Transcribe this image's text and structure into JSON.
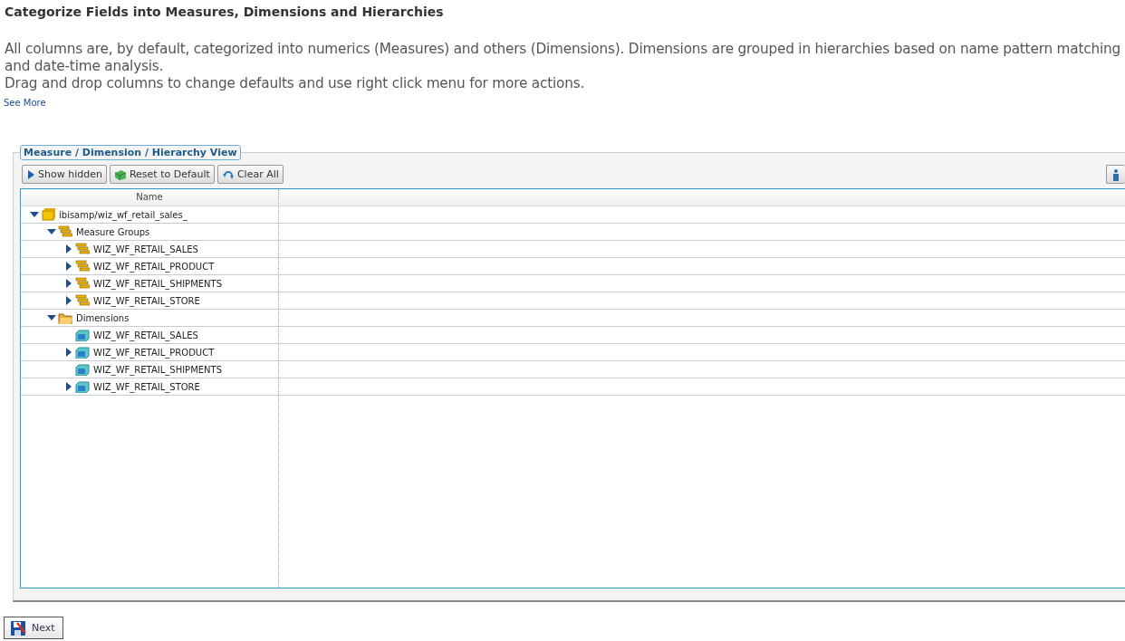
{
  "heading": "Categorize Fields into Measures, Dimensions and Hierarchies",
  "description": [
    "All columns are, by default, categorized into numerics (Measures) and others (Dimensions). Dimensions are grouped in hierarchies based on name pattern matching and date-time analysis.",
    "Drag and drop columns to change defaults and use right click menu for more actions."
  ],
  "see_more": "See More",
  "panel": {
    "legend": "Measure / Dimension / Hierarchy View",
    "toolbar": [
      {
        "kind": "show",
        "label": "Show hidden"
      },
      {
        "kind": "reset",
        "label": "Reset to Default"
      },
      {
        "kind": "clear",
        "label": "Clear All"
      }
    ],
    "tree": {
      "column": "Name",
      "nodes": [
        {
          "kind": "database",
          "label": "ibisamp/wiz_wf_retail_sales_",
          "expanded": true,
          "children": [
            {
              "kind": "measures",
              "label": "Measure Groups",
              "expanded": true,
              "children": [
                {
                  "kind": "measure",
                  "label": "WIZ_WF_RETAIL_SALES",
                  "expanded": false
                },
                {
                  "kind": "measure",
                  "label": "WIZ_WF_RETAIL_PRODUCT",
                  "expanded": false
                },
                {
                  "kind": "measure",
                  "label": "WIZ_WF_RETAIL_SHIPMENTS",
                  "expanded": false
                },
                {
                  "kind": "measure",
                  "label": "WIZ_WF_RETAIL_STORE",
                  "expanded": false
                }
              ]
            },
            {
              "kind": "folder",
              "label": "Dimensions",
              "expanded": true,
              "children": [
                {
                  "kind": "dimension",
                  "label": "WIZ_WF_RETAIL_SALES"
                },
                {
                  "kind": "dimension",
                  "label": "WIZ_WF_RETAIL_PRODUCT",
                  "expanded": false
                },
                {
                  "kind": "dimension",
                  "label": "WIZ_WF_RETAIL_SHIPMENTS"
                },
                {
                  "kind": "dimension",
                  "label": "WIZ_WF_RETAIL_STORE",
                  "expanded": false
                }
              ]
            }
          ]
        }
      ]
    }
  },
  "next_button": "Next"
}
